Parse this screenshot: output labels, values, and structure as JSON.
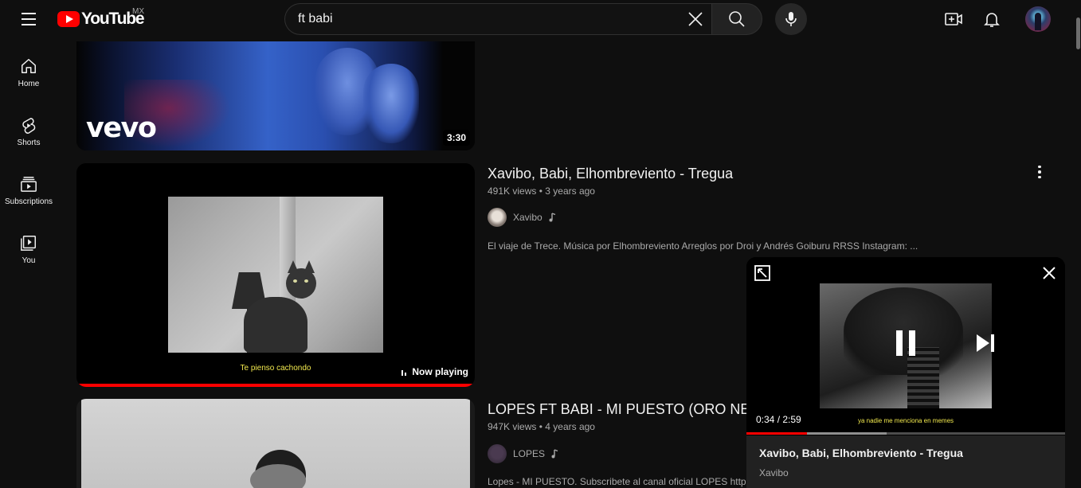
{
  "header": {
    "logo_text": "YouTube",
    "country_code": "MX",
    "search_value": "ft babi"
  },
  "guide": [
    {
      "label": "Home",
      "icon": "home-icon"
    },
    {
      "label": "Shorts",
      "icon": "shorts-icon"
    },
    {
      "label": "Subscriptions",
      "icon": "subscriptions-icon"
    },
    {
      "label": "You",
      "icon": "you-icon"
    }
  ],
  "results": [
    {
      "duration": "3:30",
      "watermark": "vevo"
    },
    {
      "title": "Xavibo, Babi, Elhombreviento - Tregua",
      "views": "491K views",
      "age": "3 years ago",
      "channel": "Xavibo",
      "description": "El viaje de Trece. Música por Elhombreviento Arreglos por Droi y Andrés Goiburu RRSS Instagram: ...",
      "subtitle": "Te pienso cachondo",
      "status": "Now playing"
    },
    {
      "title": "LOPES FT BABI - MI PUESTO (ORO NEGRO)",
      "views": "947K views",
      "age": "4 years ago",
      "channel": "LOPES",
      "description": "Lopes - MI PUESTO. Subscribete al canal oficial LOPES https://..."
    }
  ],
  "miniplayer": {
    "time": "0:34 / 2:59",
    "subtitle": "ya nadie me menciona en memes",
    "title": "Xavibo, Babi, Elhombreviento - Tregua",
    "channel": "Xavibo",
    "progress_fraction": 0.19,
    "buffer_fraction": 0.44
  },
  "colors": {
    "background": "#0f0f0f",
    "accent_red": "#ff0000",
    "subtitle_yellow": "#f2e94e"
  }
}
